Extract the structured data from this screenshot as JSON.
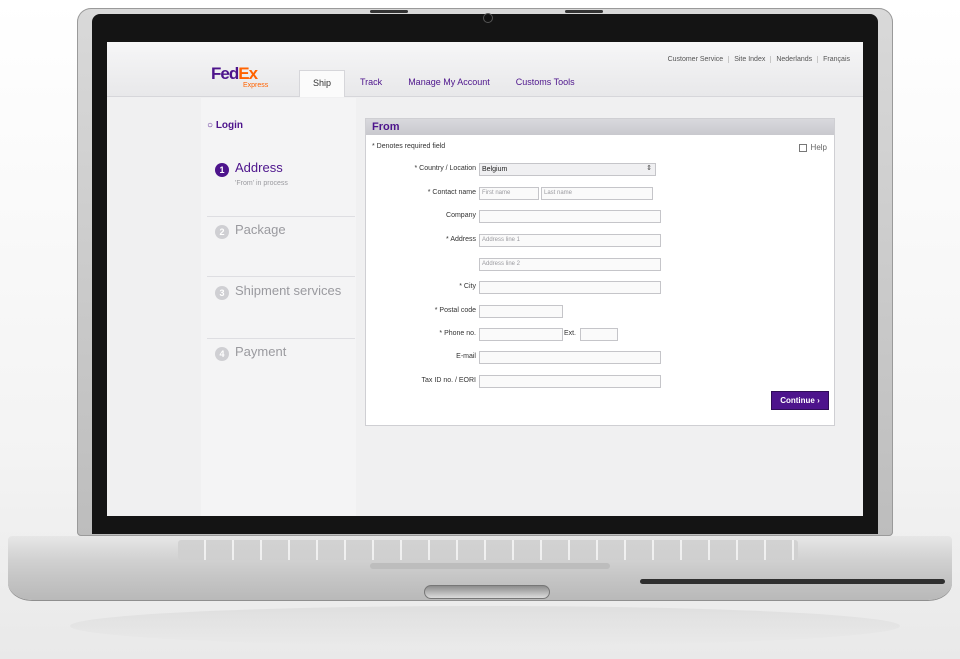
{
  "header": {
    "logo": {
      "fed": "Fed",
      "ex": "Ex",
      "sub": "Express"
    },
    "utility_links": [
      "Customer Service",
      "Site Index",
      "Nederlands",
      "Français"
    ],
    "tabs": [
      "Ship",
      "Track",
      "Manage My Account",
      "Customs Tools"
    ],
    "active_tab": "Ship"
  },
  "sidebar": {
    "login": "Login",
    "steps": [
      {
        "num": "1",
        "label": "Address",
        "status": "'From' in process",
        "current": true
      },
      {
        "num": "2",
        "label": "Package",
        "status": "",
        "current": false
      },
      {
        "num": "3",
        "label": "Shipment services",
        "status": "",
        "current": false
      },
      {
        "num": "4",
        "label": "Payment",
        "status": "",
        "current": false
      }
    ]
  },
  "form": {
    "title": "From",
    "required_note": "* Denotes required field",
    "help": "Help",
    "country_label": "* Country / Location",
    "country_value": "Belgium",
    "contact_label": "* Contact name",
    "first_name_placeholder": "First name",
    "last_name_placeholder": "Last name",
    "company_label": "Company",
    "address_label": "* Address",
    "address1_placeholder": "Address line 1",
    "address2_placeholder": "Address line 2",
    "city_label": "* City",
    "postal_label": "* Postal code",
    "phone_label": "* Phone no.",
    "ext_label": "Ext.",
    "email_label": "E-mail",
    "taxid_label": "Tax ID no. / EORI",
    "continue_label": "Continue"
  },
  "colors": {
    "brand_purple": "#4d148c",
    "brand_orange": "#ff6200"
  }
}
